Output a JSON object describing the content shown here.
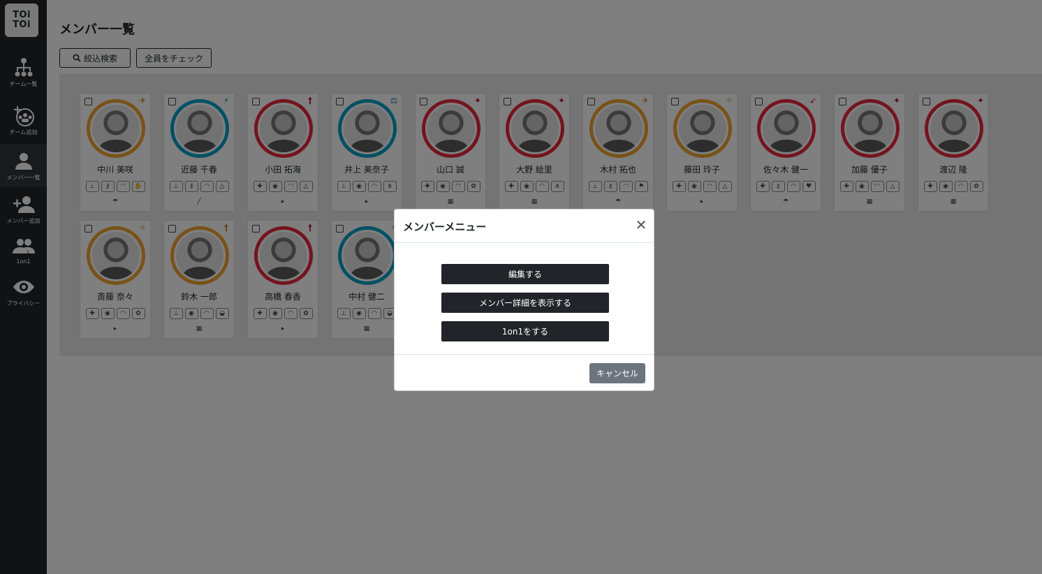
{
  "sidebar": {
    "logo": [
      "TOi",
      "TOi"
    ],
    "items": [
      {
        "label": "チーム一覧"
      },
      {
        "label": "チーム追加"
      },
      {
        "label": "メンバー一覧"
      },
      {
        "label": "メンバー追加"
      },
      {
        "label": "1on1"
      },
      {
        "label": "プライバシー"
      }
    ]
  },
  "main": {
    "title": "メンバー一覧",
    "filter_button": "絞込検索",
    "check_all_button": "全員をチェック"
  },
  "members": [
    {
      "name": "中川 美咲",
      "ring": "#f0a430",
      "icons": [
        "⊥",
        "⚷",
        "◠",
        "✋"
      ],
      "small": "☂"
    },
    {
      "name": "近藤 千春",
      "ring": "#00a0c8",
      "icons": [
        "⊥",
        "⚷",
        "◠",
        "△"
      ],
      "small": "╱"
    },
    {
      "name": "小田 拓海",
      "ring": "#e8283c",
      "icons": [
        "✚",
        "◉",
        "◠",
        "△"
      ],
      "small": "▸"
    },
    {
      "name": "井上 美奈子",
      "ring": "#00a0c8",
      "icons": [
        "⊥",
        "◉",
        "◠",
        "⋔"
      ],
      "small": "▸"
    },
    {
      "name": "山口 誠",
      "ring": "#e8283c",
      "icons": [
        "✚",
        "◉",
        "◠",
        "✿"
      ],
      "small": "▦"
    },
    {
      "name": "大野 絵里",
      "ring": "#e8283c",
      "icons": [
        "✚",
        "◉",
        "◠",
        "⋔"
      ],
      "small": "▦"
    },
    {
      "name": "木村 拓也",
      "ring": "#f0a430",
      "icons": [
        "⊥",
        "⚷",
        "◠",
        "⚑"
      ],
      "small": "☂"
    },
    {
      "name": "藤田 玲子",
      "ring": "#f0a430",
      "icons": [
        "✚",
        "◉",
        "◠",
        "△"
      ],
      "small": "▸"
    },
    {
      "name": "佐々木 健一",
      "ring": "#e8283c",
      "icons": [
        "✚",
        "⚷",
        "◠",
        "♥"
      ],
      "small": "☂"
    },
    {
      "name": "加藤 優子",
      "ring": "#e8283c",
      "icons": [
        "✚",
        "◉",
        "◠",
        "△"
      ],
      "small": "▦"
    },
    {
      "name": "渡辺 隆",
      "ring": "#e8283c",
      "icons": [
        "✚",
        "◉",
        "◠",
        "✿"
      ],
      "small": "▦"
    },
    {
      "name": "斎藤 奈々",
      "ring": "#f0a430",
      "icons": [
        "✚",
        "◉",
        "◠",
        "✿"
      ],
      "small": "▸"
    },
    {
      "name": "鈴木 一郎",
      "ring": "#f0a430",
      "icons": [
        "⊥",
        "◉",
        "◠",
        "◒"
      ],
      "small": "▦"
    },
    {
      "name": "高橋 春香",
      "ring": "#e8283c",
      "icons": [
        "✚",
        "◉",
        "◠",
        "✿"
      ],
      "small": "▸"
    },
    {
      "name": "中村 健二",
      "ring": "#00a0c8",
      "icons": [
        "⊥",
        "◉",
        "◠",
        "◒"
      ],
      "small": "▦"
    }
  ],
  "modal": {
    "title": "メンバーメニュー",
    "edit": "編集する",
    "detail": "メンバー詳細を表示する",
    "oneonone": "1on1をする",
    "cancel": "キャンセル"
  },
  "colors": {
    "sidebar_bg": "#212529",
    "primary_dark": "#212529",
    "secondary": "#6c757d",
    "ring_orange": "#f0a430",
    "ring_blue": "#00a0c8",
    "ring_red": "#e8283c"
  }
}
